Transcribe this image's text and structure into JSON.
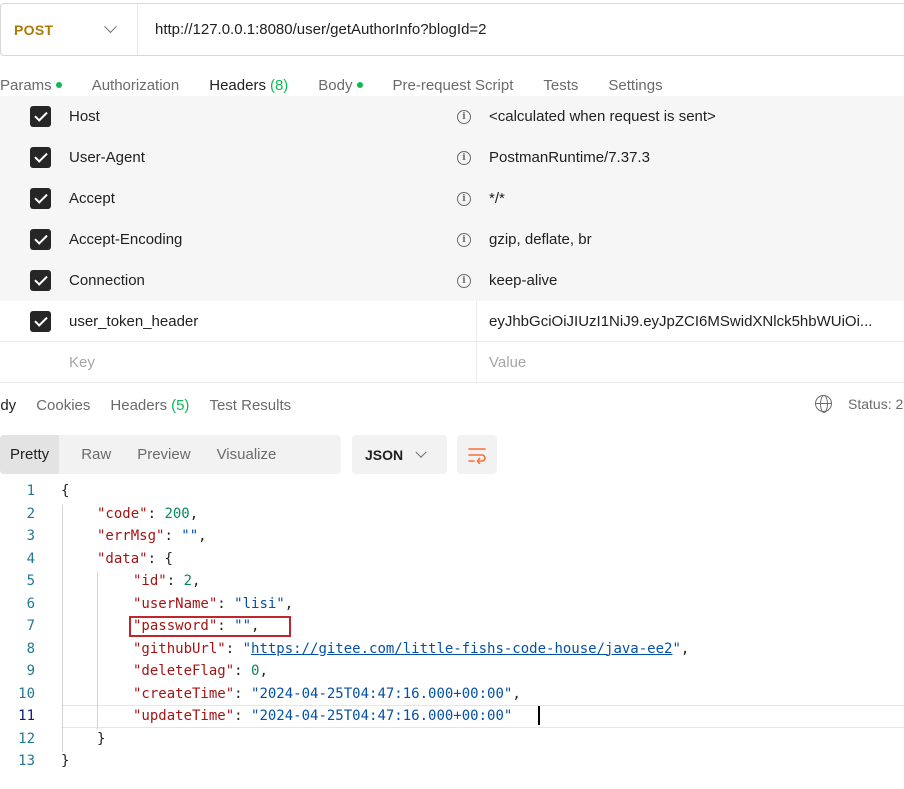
{
  "request": {
    "method": "POST",
    "url": "http://127.0.0.1:8080/user/getAuthorInfo?blogId=2"
  },
  "request_tabs": [
    {
      "label": "Params",
      "dot": true
    },
    {
      "label": "Authorization"
    },
    {
      "label": "Headers",
      "count": "(8)",
      "active": true
    },
    {
      "label": "Body",
      "dot": true
    },
    {
      "label": "Pre-request Script"
    },
    {
      "label": "Tests"
    },
    {
      "label": "Settings"
    }
  ],
  "headers": [
    {
      "key": "Host",
      "value": "<calculated when request is sent>",
      "checked": true,
      "info": true
    },
    {
      "key": "User-Agent",
      "value": "PostmanRuntime/7.37.3",
      "checked": true,
      "info": true
    },
    {
      "key": "Accept",
      "value": "*/*",
      "checked": true,
      "info": true
    },
    {
      "key": "Accept-Encoding",
      "value": "gzip, deflate, br",
      "checked": true,
      "info": true
    },
    {
      "key": "Connection",
      "value": "keep-alive",
      "checked": true,
      "info": true
    },
    {
      "key": "user_token_header",
      "value": "eyJhbGciOiJIUzI1NiJ9.eyJpZCI6MSwidXNlck5hbWUiOi...",
      "checked": true,
      "info": false
    }
  ],
  "new_header": {
    "key_placeholder": "Key",
    "value_placeholder": "Value"
  },
  "response_tabs": [
    {
      "label": "ody",
      "active": true
    },
    {
      "label": "Cookies"
    },
    {
      "label": "Headers",
      "count": "(5)"
    },
    {
      "label": "Test Results"
    }
  ],
  "status_label": "Status: 2",
  "format_tabs": [
    "Pretty",
    "Raw",
    "Preview",
    "Visualize"
  ],
  "format_select": "JSON",
  "icons": {
    "method": "chevron-down-icon",
    "globe": "globe-icon",
    "wrap": "wrap-lines-icon",
    "info": "info-icon",
    "check": "checkbox-checked-icon"
  },
  "colors": {
    "accent": "#ff6c37",
    "success": "#0cbb52",
    "method": "#ad7a03",
    "highlight_box": "#c0262d"
  },
  "code_lines": [
    {
      "n": "1",
      "indent": 0,
      "parts": [
        [
          "p",
          "{"
        ]
      ]
    },
    {
      "n": "2",
      "indent": 1,
      "parts": [
        [
          "k",
          "\"code\""
        ],
        [
          "p",
          ": "
        ],
        [
          "n",
          "200"
        ],
        [
          "p",
          ","
        ]
      ]
    },
    {
      "n": "3",
      "indent": 1,
      "parts": [
        [
          "k",
          "\"errMsg\""
        ],
        [
          "p",
          ": "
        ],
        [
          "s",
          "\"\""
        ],
        [
          "p",
          ","
        ]
      ]
    },
    {
      "n": "4",
      "indent": 1,
      "parts": [
        [
          "k",
          "\"data\""
        ],
        [
          "p",
          ": "
        ],
        [
          "p",
          "{"
        ]
      ]
    },
    {
      "n": "5",
      "indent": 2,
      "parts": [
        [
          "k",
          "\"id\""
        ],
        [
          "p",
          ": "
        ],
        [
          "n",
          "2"
        ],
        [
          "p",
          ","
        ]
      ]
    },
    {
      "n": "6",
      "indent": 2,
      "parts": [
        [
          "k",
          "\"userName\""
        ],
        [
          "p",
          ": "
        ],
        [
          "s",
          "\"lisi\""
        ],
        [
          "p",
          ","
        ]
      ]
    },
    {
      "n": "7",
      "indent": 2,
      "parts": [
        [
          "k",
          "\"password\""
        ],
        [
          "p",
          ": "
        ],
        [
          "s",
          "\"\""
        ],
        [
          "p",
          ","
        ]
      ]
    },
    {
      "n": "8",
      "indent": 2,
      "parts": [
        [
          "k",
          "\"githubUrl\""
        ],
        [
          "p",
          ": "
        ],
        [
          "s",
          "\""
        ],
        [
          "u",
          "https://gitee.com/little-fishs-code-house/java-ee2"
        ],
        [
          "s",
          "\""
        ],
        [
          "p",
          ","
        ]
      ]
    },
    {
      "n": "9",
      "indent": 2,
      "parts": [
        [
          "k",
          "\"deleteFlag\""
        ],
        [
          "p",
          ": "
        ],
        [
          "n",
          "0"
        ],
        [
          "p",
          ","
        ]
      ]
    },
    {
      "n": "10",
      "indent": 2,
      "parts": [
        [
          "k",
          "\"createTime\""
        ],
        [
          "p",
          ": "
        ],
        [
          "s",
          "\"2024-04-25T04:47:16.000+00:00\""
        ],
        [
          "p",
          ","
        ]
      ]
    },
    {
      "n": "11",
      "indent": 2,
      "parts": [
        [
          "k",
          "\"updateTime\""
        ],
        [
          "p",
          ": "
        ],
        [
          "s",
          "\"2024-04-25T04:47:16.000+00:00\""
        ]
      ],
      "current": true
    },
    {
      "n": "12",
      "indent": 1,
      "parts": [
        [
          "p",
          "}"
        ]
      ]
    },
    {
      "n": "13",
      "indent": 0,
      "parts": [
        [
          "p",
          "}"
        ]
      ]
    }
  ]
}
